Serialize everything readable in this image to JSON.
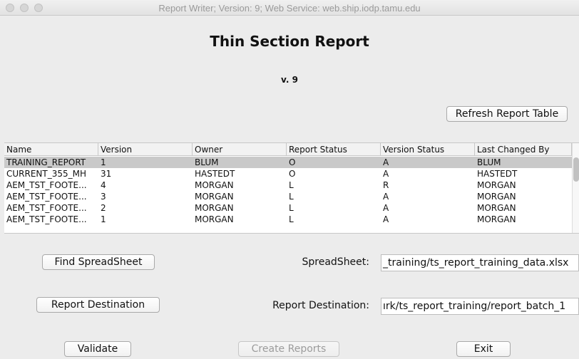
{
  "window": {
    "title": "Report Writer; Version: 9; Web Service: web.ship.iodp.tamu.edu"
  },
  "header": {
    "title": "Thin Section Report",
    "version": "v. 9"
  },
  "toolbar": {
    "refresh_label": "Refresh Report Table"
  },
  "table": {
    "columns": [
      "Name",
      "Version",
      "Owner",
      "Report Status",
      "Version Status",
      "Last Changed By"
    ],
    "rows": [
      [
        "TRAINING_REPORT",
        "1",
        "BLUM",
        "O",
        "A",
        "BLUM"
      ],
      [
        "CURRENT_355_MH",
        "31",
        "HASTEDT",
        "O",
        "A",
        "HASTEDT"
      ],
      [
        "AEM_TST_FOOTE...",
        "4",
        "MORGAN",
        "L",
        "R",
        "MORGAN"
      ],
      [
        "AEM_TST_FOOTE...",
        "3",
        "MORGAN",
        "L",
        "A",
        "MORGAN"
      ],
      [
        "AEM_TST_FOOTE...",
        "2",
        "MORGAN",
        "L",
        "A",
        "MORGAN"
      ],
      [
        "AEM_TST_FOOTE...",
        "1",
        "MORGAN",
        "L",
        "A",
        "MORGAN"
      ]
    ],
    "selected_row": 0
  },
  "form": {
    "find_spreadsheet_label": "Find SpreadSheet",
    "spreadsheet_label": "SpreadSheet:",
    "spreadsheet_value": "_training/ts_report_training_data.xlsx",
    "report_destination_button": "Report Destination",
    "report_destination_label": "Report Destination:",
    "report_destination_value": "ırk/ts_report_training/report_batch_1"
  },
  "actions": {
    "validate": "Validate",
    "create_reports": "Create Reports",
    "exit": "Exit"
  }
}
